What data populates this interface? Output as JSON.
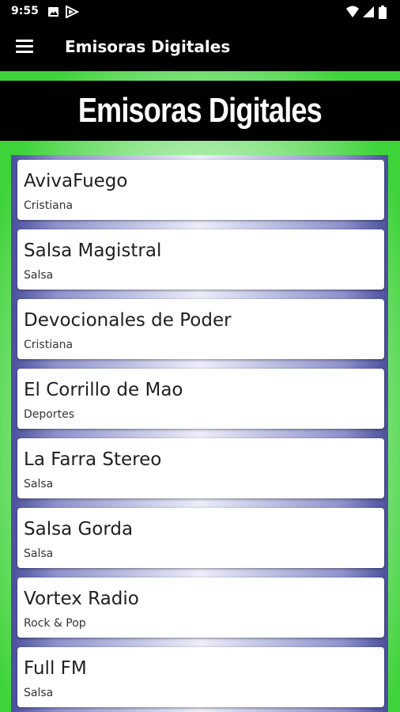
{
  "status": {
    "time": "9:55",
    "icons": [
      "image-notification-icon",
      "play-store-icon",
      "wifi-icon",
      "signal-icon",
      "battery-icon"
    ]
  },
  "appbar": {
    "title": "Emisoras Digitales",
    "menu_icon": "hamburger-menu-icon"
  },
  "banner": {
    "text": "Emisoras Digitales"
  },
  "colors": {
    "accent_green": "#3fd33a",
    "frame_blue": "#4a4f9c",
    "bar": "#000000"
  },
  "stations": [
    {
      "name": "AvivaFuego",
      "genre": "Cristiana"
    },
    {
      "name": "Salsa Magistral",
      "genre": "Salsa"
    },
    {
      "name": "Devocionales de Poder",
      "genre": "Cristiana"
    },
    {
      "name": "El Corrillo de Mao",
      "genre": "Deportes"
    },
    {
      "name": "La Farra Stereo",
      "genre": "Salsa"
    },
    {
      "name": "Salsa Gorda",
      "genre": "Salsa"
    },
    {
      "name": "Vortex Radio",
      "genre": "Rock & Pop"
    },
    {
      "name": "Full FM",
      "genre": "Salsa"
    }
  ]
}
